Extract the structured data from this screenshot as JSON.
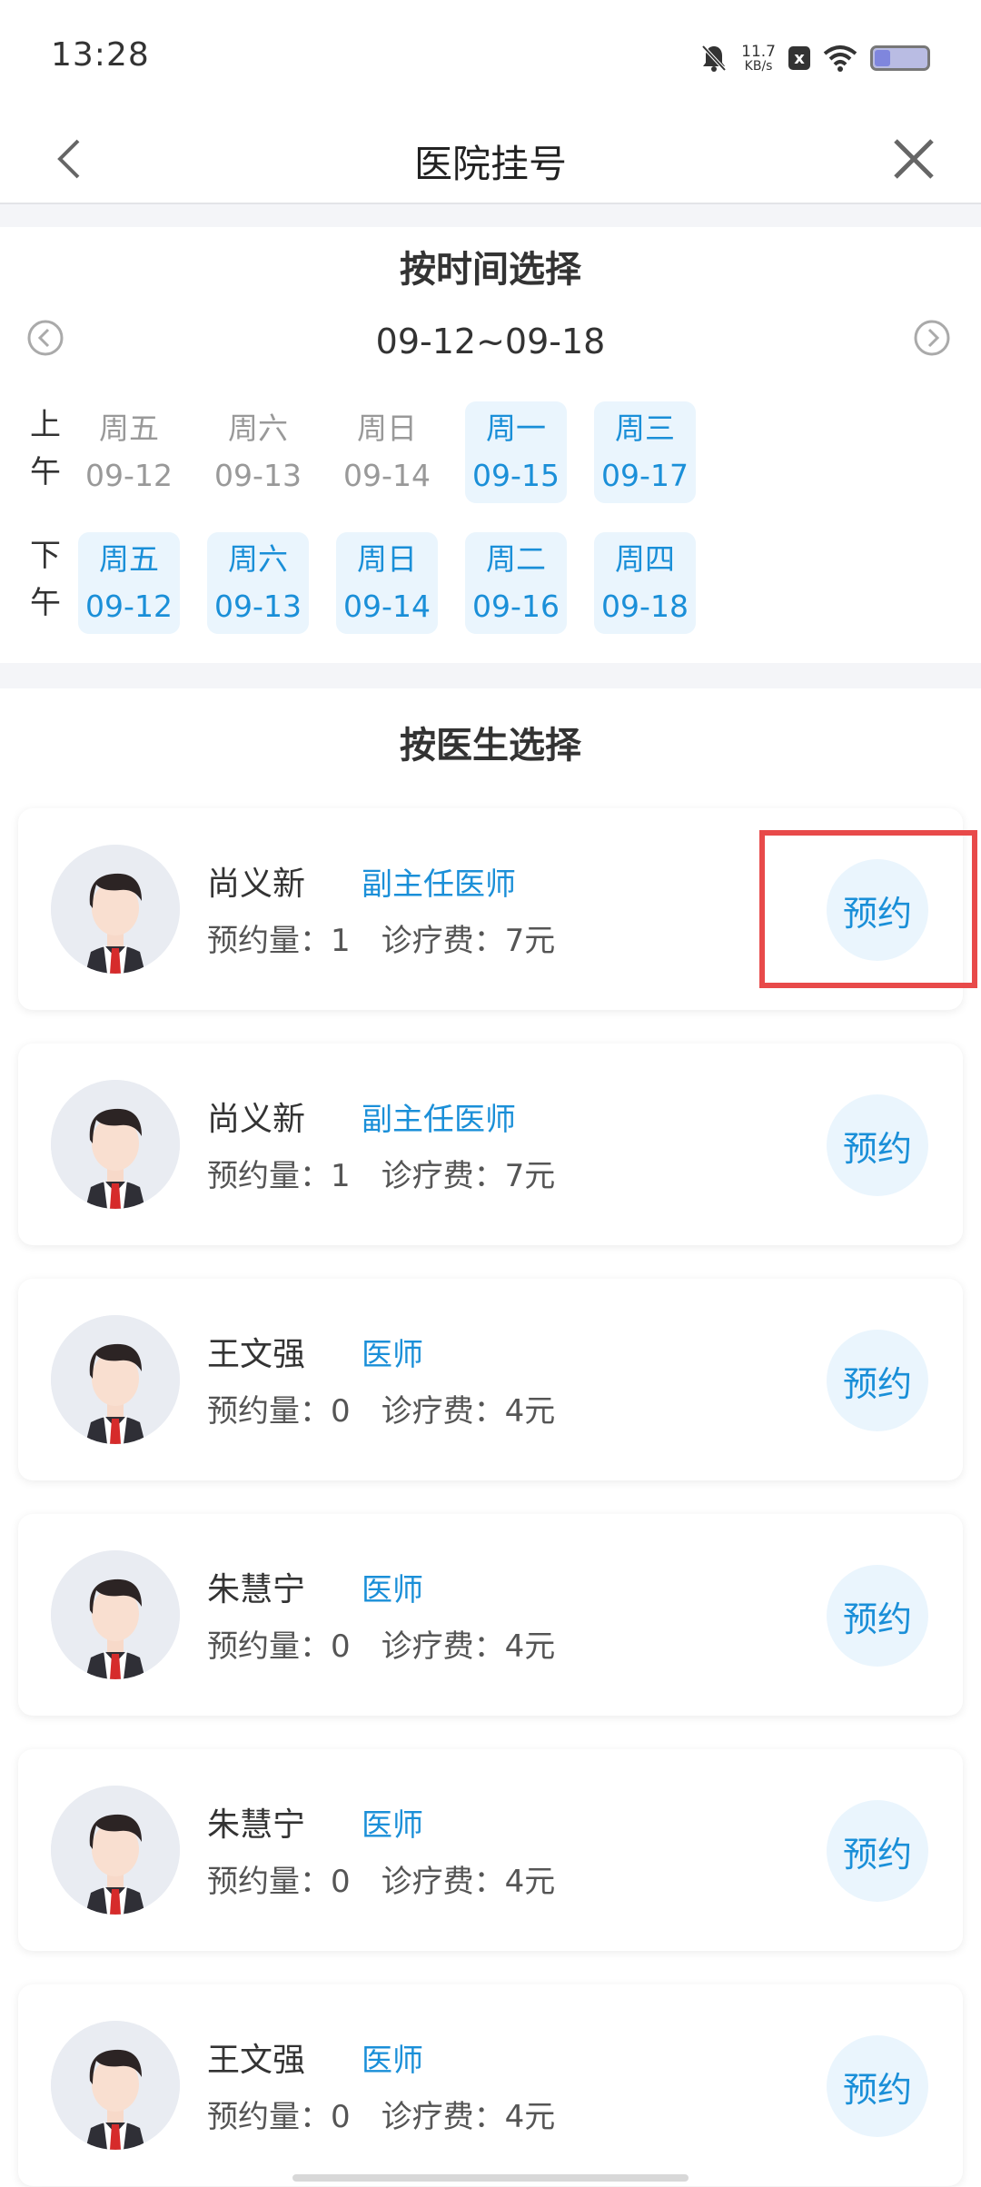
{
  "status_bar": {
    "time": "13:28",
    "net_speed": "11.7",
    "net_unit": "KB/s",
    "x_badge": "x"
  },
  "header": {
    "title": "医院挂号"
  },
  "time_section": {
    "title": "按时间选择",
    "week_range": "09-12~09-18",
    "am_label": [
      "上",
      "午"
    ],
    "pm_label": [
      "下",
      "午"
    ],
    "am_days": [
      {
        "day": "周五",
        "date": "09-12",
        "available": false
      },
      {
        "day": "周六",
        "date": "09-13",
        "available": false
      },
      {
        "day": "周日",
        "date": "09-14",
        "available": false
      },
      {
        "day": "周一",
        "date": "09-15",
        "available": true
      },
      {
        "day": "周三",
        "date": "09-17",
        "available": true
      }
    ],
    "pm_days": [
      {
        "day": "周五",
        "date": "09-12",
        "available": true
      },
      {
        "day": "周六",
        "date": "09-13",
        "available": true
      },
      {
        "day": "周日",
        "date": "09-14",
        "available": true
      },
      {
        "day": "周二",
        "date": "09-16",
        "available": true
      },
      {
        "day": "周四",
        "date": "09-18",
        "available": true
      }
    ]
  },
  "doctor_section": {
    "title": "按医生选择",
    "doctors": [
      {
        "name": "尚义新",
        "title": "副主任医师",
        "count_label": "预约量：",
        "count": "1",
        "fee_label": "诊疗费：",
        "fee": "7元",
        "book": "预约"
      },
      {
        "name": "尚义新",
        "title": "副主任医师",
        "count_label": "预约量：",
        "count": "1",
        "fee_label": "诊疗费：",
        "fee": "7元",
        "book": "预约"
      },
      {
        "name": "王文强",
        "title": "医师",
        "count_label": "预约量：",
        "count": "0",
        "fee_label": "诊疗费：",
        "fee": "4元",
        "book": "预约"
      },
      {
        "name": "朱慧宁",
        "title": "医师",
        "count_label": "预约量：",
        "count": "0",
        "fee_label": "诊疗费：",
        "fee": "4元",
        "book": "预约"
      },
      {
        "name": "朱慧宁",
        "title": "医师",
        "count_label": "预约量：",
        "count": "0",
        "fee_label": "诊疗费：",
        "fee": "4元",
        "book": "预约"
      },
      {
        "name": "王文强",
        "title": "医师",
        "count_label": "预约量：",
        "count": "0",
        "fee_label": "诊疗费：",
        "fee": "4元",
        "book": "预约"
      }
    ]
  },
  "colors": {
    "accent": "#1a8fd8",
    "accent_bg": "#eaf5fd",
    "highlight": "#e84a4a"
  }
}
